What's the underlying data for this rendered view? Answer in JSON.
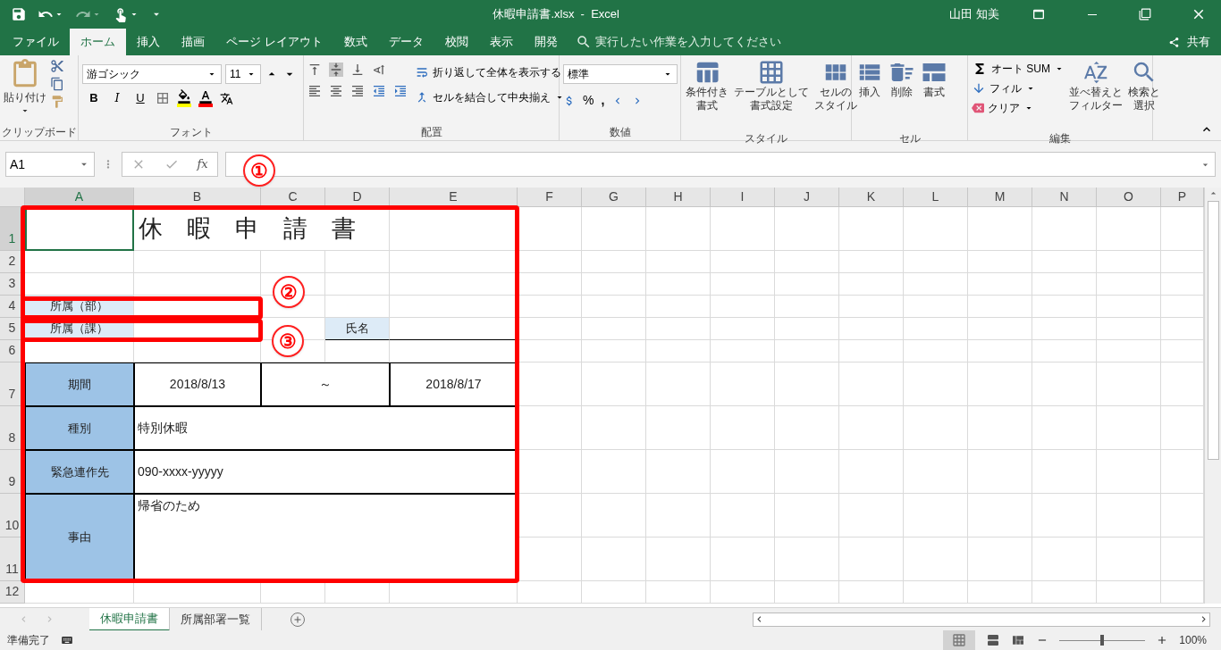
{
  "title_bar": {
    "title": "休暇申請書.xlsx  -  Excel",
    "user": "山田 知美"
  },
  "menu_tabs": [
    {
      "label": "ファイル",
      "selected": false
    },
    {
      "label": "ホーム",
      "selected": true
    },
    {
      "label": "挿入",
      "selected": false
    },
    {
      "label": "描画",
      "selected": false
    },
    {
      "label": "ページ レイアウト",
      "selected": false
    },
    {
      "label": "数式",
      "selected": false
    },
    {
      "label": "データ",
      "selected": false
    },
    {
      "label": "校閲",
      "selected": false
    },
    {
      "label": "表示",
      "selected": false
    },
    {
      "label": "開発",
      "selected": false
    }
  ],
  "tell_me": {
    "placeholder": "実行したい作業を入力してください"
  },
  "share": "共有",
  "ribbon": {
    "clipboard": {
      "label": "クリップボード",
      "paste": "貼り付け"
    },
    "font": {
      "label": "フォント",
      "font_name": "游ゴシック",
      "font_size": "11",
      "bold": "B",
      "italic": "I",
      "underline": "U"
    },
    "alignment": {
      "label": "配置",
      "wrap": "折り返して全体を表示する",
      "merge": "セルを結合して中央揃え"
    },
    "number": {
      "label": "数値",
      "format": "標準",
      "percent": "%",
      "comma": ","
    },
    "styles": {
      "label": "スタイル",
      "buttons": [
        {
          "lines": [
            "条件付き",
            "書式"
          ]
        },
        {
          "lines": [
            "テーブルとして",
            "書式設定"
          ]
        },
        {
          "lines": [
            "セルの",
            "スタイル"
          ]
        }
      ]
    },
    "cells": {
      "label": "セル",
      "buttons": [
        "挿入",
        "削除",
        "書式"
      ]
    },
    "editing": {
      "label": "編集",
      "autosum": "オート SUM",
      "fill": "フィル",
      "clear": "クリア",
      "sort": {
        "lines": [
          "並べ替えと",
          "フィルター"
        ]
      },
      "find": {
        "lines": [
          "検索と",
          "選択"
        ]
      }
    }
  },
  "formula_bar": {
    "name_box": "A1",
    "fx": "fx"
  },
  "sheet": {
    "columns": [
      "A",
      "B",
      "C",
      "D",
      "E",
      "F",
      "G",
      "H",
      "I",
      "J",
      "K",
      "L",
      "M",
      "N",
      "O",
      "P"
    ],
    "rows": [
      {
        "header": "1",
        "cells": [
          {
            "kind": "empty"
          },
          {
            "kind": "title",
            "text": "休　暇　申　請　書"
          },
          {
            "kind": "merged-left"
          },
          {
            "kind": "merged-left"
          }
        ]
      },
      {
        "header": "2"
      },
      {
        "header": "3"
      },
      {
        "header": "4",
        "cells": [
          {
            "kind": "label",
            "text": "所属（部）",
            "color": "#ddebf7"
          }
        ]
      },
      {
        "header": "5",
        "cells": [
          {
            "kind": "label",
            "text": "所属（課）",
            "color": "#ddebf7"
          },
          {
            "kind": "empty"
          },
          {
            "kind": "empty"
          },
          {
            "kind": "label-underline",
            "text": "氏名",
            "color": "#ddebf7"
          },
          {
            "kind": "underline"
          }
        ]
      },
      {
        "header": "6"
      },
      {
        "header": "7",
        "cells": [
          {
            "kind": "header",
            "text": "期間",
            "color": "#9dc3e6"
          },
          {
            "kind": "center",
            "text": "2018/8/13"
          },
          {
            "kind": "center",
            "text": "～"
          },
          {
            "kind": "merged-left"
          },
          {
            "kind": "center",
            "text": "2018/8/17"
          }
        ]
      },
      {
        "header": "8",
        "cells": [
          {
            "kind": "header",
            "text": "種別",
            "color": "#9dc3e6"
          },
          {
            "kind": "left",
            "text": "特別休暇"
          },
          {
            "kind": "merged-left"
          },
          {
            "kind": "merged-left"
          },
          {
            "kind": "merged-left"
          }
        ]
      },
      {
        "header": "9",
        "cells": [
          {
            "kind": "header",
            "text": "緊急連作先",
            "color": "#9dc3e6"
          },
          {
            "kind": "left",
            "text": "090-xxxx-yyyyy"
          },
          {
            "kind": "merged-left"
          },
          {
            "kind": "merged-left"
          },
          {
            "kind": "merged-left"
          }
        ]
      },
      {
        "header": "10",
        "cells": [
          {
            "kind": "header",
            "text": "事由",
            "color": "#9dc3e6"
          },
          {
            "kind": "top",
            "text": "帰省のため"
          },
          {
            "kind": "merged-left"
          },
          {
            "kind": "merged-left"
          },
          {
            "kind": "merged-left"
          }
        ]
      },
      {
        "header": "11",
        "cells": [
          {
            "kind": "merged-up"
          },
          {
            "kind": "merged-up"
          },
          {
            "kind": "merged-up"
          },
          {
            "kind": "merged-up"
          },
          {
            "kind": "merged-up"
          }
        ]
      },
      {
        "header": "12"
      }
    ],
    "markers": [
      "①",
      "②",
      "③"
    ]
  },
  "sheet_tabs": [
    {
      "label": "休暇申請書",
      "selected": true
    },
    {
      "label": "所属部署一覧",
      "selected": false
    }
  ],
  "status_bar": {
    "status": "準備完了",
    "zoom": "100%",
    "level": 0.5
  }
}
